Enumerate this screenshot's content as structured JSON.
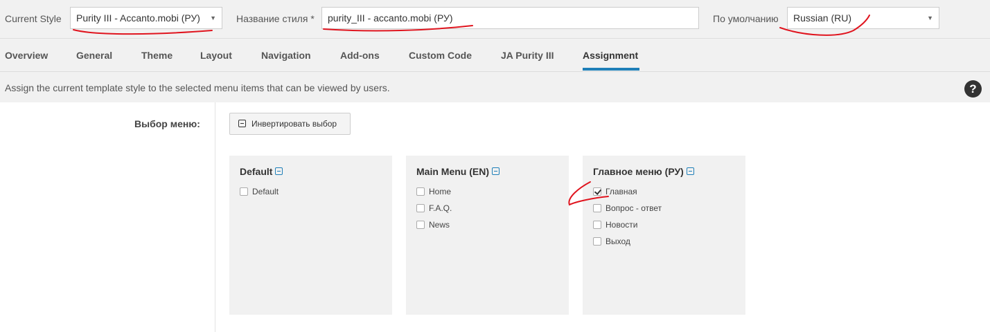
{
  "top": {
    "current_style_label": "Current Style",
    "current_style_value": "Purity III - Accanto.mobi (РУ)",
    "style_name_label": "Название стиля *",
    "style_name_value": "purity_III - accanto.mobi (РУ)",
    "default_label": "По умолчанию",
    "default_value": "Russian (RU)",
    "select_arrow_icon": "caret-down-icon"
  },
  "tabs": [
    {
      "label": "Overview"
    },
    {
      "label": "General"
    },
    {
      "label": "Theme"
    },
    {
      "label": "Layout"
    },
    {
      "label": "Navigation"
    },
    {
      "label": "Add-ons"
    },
    {
      "label": "Custom Code"
    },
    {
      "label": "JA Purity III"
    },
    {
      "label": "Assignment",
      "active": true
    }
  ],
  "description": "Assign the current template style to the selected menu items that can be viewed by users.",
  "help_icon": "?",
  "assignment": {
    "label": "Выбор меню:",
    "invert_button": "Инвертировать выбор",
    "menus": [
      {
        "title": "Default",
        "items": [
          {
            "label": "Default",
            "checked": false
          }
        ]
      },
      {
        "title": "Main Menu (EN)",
        "items": [
          {
            "label": "Home",
            "checked": false
          },
          {
            "label": "F.A.Q.",
            "checked": false
          },
          {
            "label": "News",
            "checked": false
          }
        ]
      },
      {
        "title": "Главное меню (РУ)",
        "items": [
          {
            "label": "Главная",
            "checked": true
          },
          {
            "label": "Вопрос - ответ",
            "checked": false
          },
          {
            "label": "Новости",
            "checked": false
          },
          {
            "label": "Выход",
            "checked": false
          }
        ]
      }
    ]
  },
  "colors": {
    "accent": "#1e7fb8",
    "annotation": "#e0141e",
    "panel_bg": "#f1f1f1"
  }
}
